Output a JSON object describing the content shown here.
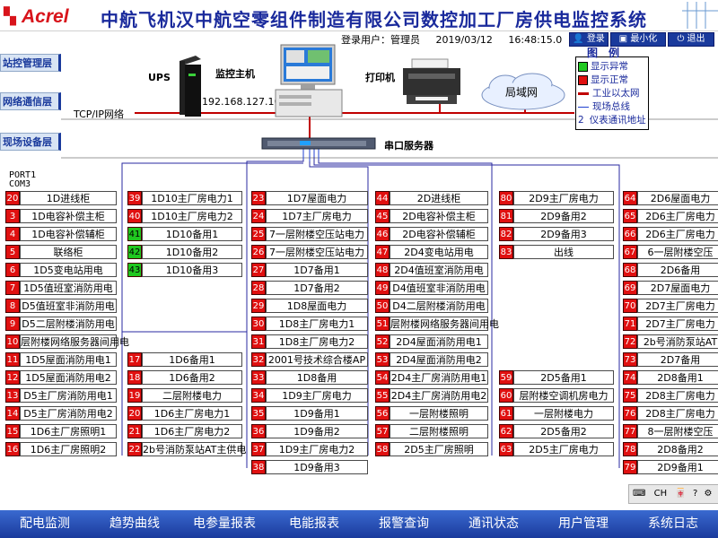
{
  "header": {
    "logo_text": "Acrel",
    "title": "中航飞机汉中航空零组件制造有限公司数控加工厂房供电监控系统"
  },
  "info": {
    "user_label": "登录用户：管理员",
    "date": "2019/03/12",
    "time": "16:48:15.0"
  },
  "toolbar": {
    "login": "登录",
    "minimize": "最小化",
    "exit": "退出"
  },
  "layers": {
    "station": "站控管理层",
    "network": "网络通信层",
    "field": "现场设备层"
  },
  "topology": {
    "ups": "UPS",
    "host": "监控主机",
    "ip": "192.168.127.100",
    "printer": "打印机",
    "lan": "局域网",
    "tcpip": "TCP/IP网络",
    "serial_server": "串口服务器",
    "port": "PORT1",
    "com": "COM3"
  },
  "legend": {
    "title": "图　例",
    "abnormal": "显示异常",
    "normal": "显示正常",
    "ethernet": "工业以太网",
    "fieldbus": "现场总线",
    "address": "仪表通讯地址",
    "address_num": "2",
    "colors": {
      "abnormal": "#20c820",
      "normal": "#e01010",
      "ethernet": "#c00000",
      "fieldbus": "#2040d0"
    }
  },
  "columns": [
    {
      "rows": [
        [
          "20",
          "1D进线柜"
        ],
        [
          "3",
          "1D电容补偿主柜"
        ],
        [
          "4",
          "1D电容补偿辅柜"
        ],
        [
          "5",
          "联络柜"
        ],
        [
          "6",
          "1D5变电站用电"
        ],
        [
          "7",
          "1D5值班室消防用电"
        ],
        [
          "8",
          "D5值班室非消防用电"
        ],
        [
          "9",
          "D5二层附楼消防用电"
        ],
        [
          "10",
          "层附楼网络服务器间用电"
        ],
        [
          "11",
          "1D5屋面消防用电1"
        ],
        [
          "12",
          "1D5屋面消防用电2"
        ],
        [
          "13",
          "D5主厂房消防用电1"
        ],
        [
          "14",
          "D5主厂房消防用电2"
        ],
        [
          "15",
          "1D6主厂房照明1"
        ],
        [
          "16",
          "1D6主厂房照明2"
        ]
      ]
    },
    {
      "rows": [
        [
          "39",
          "1D10主厂房电力1"
        ],
        [
          "40",
          "1D10主厂房电力2"
        ],
        [
          "41",
          "1D10备用1"
        ],
        [
          "42",
          "1D10备用2"
        ],
        [
          "43",
          "1D10备用3"
        ]
      ],
      "rows2": [
        [
          "17",
          "1D6备用1"
        ],
        [
          "18",
          "1D6备用2"
        ],
        [
          "19",
          "二层附楼电力"
        ],
        [
          "20",
          "1D6主厂房电力1"
        ],
        [
          "21",
          "1D6主厂房电力2"
        ],
        [
          "22",
          "2b号消防泵站AT主供电"
        ]
      ]
    },
    {
      "rows": [
        [
          "23",
          "1D7屋面电力"
        ],
        [
          "24",
          "1D7主厂房电力"
        ],
        [
          "25",
          "7一层附楼空压站电力"
        ],
        [
          "26",
          "7一层附楼空压站电力"
        ],
        [
          "27",
          "1D7备用1"
        ],
        [
          "28",
          "1D7备用2"
        ],
        [
          "29",
          "1D8屋面电力"
        ],
        [
          "30",
          "1D8主厂房电力1"
        ],
        [
          "31",
          "1D8主厂房电力2"
        ],
        [
          "32",
          "2001号技术综合楼AP"
        ],
        [
          "33",
          "1D8备用"
        ],
        [
          "34",
          "1D9主厂房电力"
        ],
        [
          "35",
          "1D9备用1"
        ],
        [
          "36",
          "1D9备用2"
        ],
        [
          "37",
          "1D9主厂房电力2"
        ],
        [
          "38",
          "1D9备用3"
        ]
      ]
    },
    {
      "rows": [
        [
          "44",
          "2D进线柜"
        ],
        [
          "45",
          "2D电容补偿主柜"
        ],
        [
          "46",
          "2D电容补偿辅柜"
        ],
        [
          "47",
          "2D4变电站用电"
        ],
        [
          "48",
          "2D4值班室消防用电"
        ],
        [
          "49",
          "D4值班室非消防用电"
        ],
        [
          "50",
          "D4二层附楼消防用电"
        ],
        [
          "51",
          "层附楼网络服务器间用电"
        ],
        [
          "52",
          "2D4屋面消防用电1"
        ],
        [
          "53",
          "2D4屋面消防用电2"
        ],
        [
          "54",
          "2D4主厂房消防用电1"
        ],
        [
          "55",
          "2D4主厂房消防用电2"
        ],
        [
          "56",
          "一层附楼照明"
        ],
        [
          "57",
          "二层附楼照明"
        ],
        [
          "58",
          "2D5主厂房照明"
        ]
      ]
    },
    {
      "rows": [
        [
          "80",
          "2D9主厂房电力"
        ],
        [
          "81",
          "2D9备用2"
        ],
        [
          "82",
          "2D9备用3"
        ],
        [
          "83",
          "出线"
        ]
      ],
      "rows2": [
        [
          "59",
          "2D5备用1"
        ],
        [
          "60",
          "层附楼空调机房电力"
        ],
        [
          "61",
          "一层附楼电力"
        ],
        [
          "62",
          "2D5备用2"
        ],
        [
          "63",
          "2D5主厂房电力"
        ]
      ]
    },
    {
      "rows": [
        [
          "64",
          "2D6屋面电力"
        ],
        [
          "65",
          "2D6主厂房电力"
        ],
        [
          "66",
          "2D6主厂房电力"
        ],
        [
          "67",
          "6一层附楼空压"
        ],
        [
          "68",
          "2D6备用"
        ],
        [
          "69",
          "2D7屋面电力"
        ],
        [
          "70",
          "2D7主厂房电力"
        ],
        [
          "71",
          "2D7主厂房电力"
        ],
        [
          "72",
          "2b号消防泵站AT"
        ],
        [
          "73",
          "2D7备用"
        ],
        [
          "74",
          "2D8备用1"
        ],
        [
          "75",
          "2D8主厂房电力"
        ],
        [
          "76",
          "2D8主厂房电力"
        ],
        [
          "77",
          "8一层附楼空压"
        ],
        [
          "78",
          "2D8备用2"
        ],
        [
          "79",
          "2D9备用1"
        ]
      ]
    }
  ],
  "nav": [
    "配电监测",
    "趋势曲线",
    "电参量报表",
    "电能报表",
    "报警查询",
    "通讯状态",
    "用户管理",
    "系统日志"
  ],
  "tray": {
    "lang": "CH"
  }
}
